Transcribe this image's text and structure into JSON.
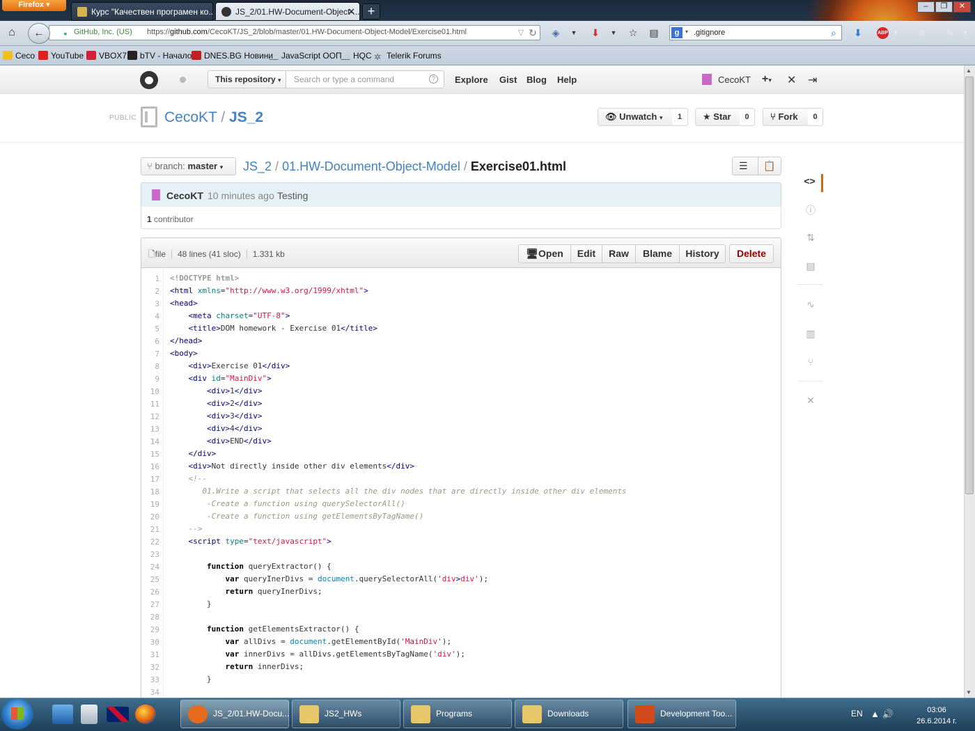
{
  "browser": {
    "menu_label": "Firefox",
    "tabs": [
      {
        "label": "Курс \"Качествен програмен ко...",
        "active": false
      },
      {
        "label": "JS_2/01.HW-Document-Object-...",
        "active": true
      }
    ],
    "new_tab": "+",
    "identity": "GitHub, Inc. (US)",
    "url_prefix": "https://",
    "url_host": "github.com",
    "url_path": "/CecoKT/JS_2/blob/master/01.HW-Document-Object-Model/Exercise01.html",
    "search_value": ".gitignore",
    "window_buttons": [
      "–",
      "❐",
      "✕"
    ]
  },
  "bookmarks": [
    {
      "label": "Ceco",
      "color": "#f0c020"
    },
    {
      "label": "YouTube",
      "color": "#e02020"
    },
    {
      "label": "VBOX7",
      "color": "#d0203a"
    },
    {
      "label": "bTV - Начало",
      "color": "#222222"
    },
    {
      "label": "DNES.BG Новини",
      "color": "#c02020"
    },
    {
      "label": "JavaScript ООП",
      "color": "#666666"
    },
    {
      "label": "HQC",
      "color": "#666666"
    },
    {
      "label": "Telerik Forums",
      "color": "#666666"
    }
  ],
  "github": {
    "scope_label": "This repository",
    "search_placeholder": "Search or type a command",
    "search_help": "?",
    "nav": [
      "Explore",
      "Gist",
      "Blog",
      "Help"
    ],
    "username": "CecoKT",
    "add_icon": "+",
    "settings_icon": "✕",
    "signout_icon": "⇥"
  },
  "repo": {
    "visibility": "PUBLIC",
    "owner": "CecoKT",
    "separator": "/",
    "name": "JS_2",
    "unwatch_label": "Unwatch",
    "unwatch_count": "1",
    "star_label": "Star",
    "star_count": "0",
    "fork_label": "Fork",
    "fork_count": "0"
  },
  "file_nav": {
    "branch_prefix": "branch:",
    "branch": "master",
    "crumb_root": "JS_2",
    "crumb_sep": "/",
    "crumb_folder": "01.HW-Document-Object-Model",
    "crumb_file": "Exercise01.html"
  },
  "commit": {
    "author": "CecoKT",
    "time": "10 minutes ago",
    "message": "Testing",
    "contributors_count": "1",
    "contributors_label": "contributor"
  },
  "file": {
    "type_label": "file",
    "lines": "48 lines (41 sloc)",
    "size": "1.331 kb",
    "buttons": [
      "Open",
      "Edit",
      "Raw",
      "Blame",
      "History"
    ],
    "delete_label": "Delete"
  },
  "code_lines": [
    "<!DOCTYPE html>",
    "<html xmlns=\"http://www.w3.org/1999/xhtml\">",
    "<head>",
    "    <meta charset=\"UTF-8\">",
    "    <title>DOM homework - Exercise 01</title>",
    "</head>",
    "<body>",
    "    <div>Exercise 01</div>",
    "    <div id=\"MainDiv\">",
    "        <div>1</div>",
    "        <div>2</div>",
    "        <div>3</div>",
    "        <div>4</div>",
    "        <div>END</div>",
    "    </div>",
    "    <div>Not directly inside other div elements</div>",
    "    <!--",
    "       01.Write a script that selects all the div nodes that are directly inside other div elements",
    "        -Create a function using querySelectorAll()",
    "        -Create a function using getElementsByTagName()",
    "    -->",
    "    <script type=\"text/javascript\">",
    "",
    "        function queryExtractor() {",
    "            var queryInerDivs = document.querySelectorAll('div>div');",
    "            return queryInerDivs;",
    "        }",
    "",
    "        function getElementsExtractor() {",
    "            var allDivs = document.getElementById('MainDiv');",
    "            var innerDivs = allDivs.getElementsByTagName('div');",
    "            return innerDivs;",
    "        }",
    ""
  ],
  "repo_sidenav": [
    "code-icon",
    "issues-icon",
    "pull-requests-icon",
    "wiki-icon",
    "pulse-icon",
    "graphs-icon",
    "network-icon",
    "settings-icon"
  ],
  "taskbar": {
    "items": [
      {
        "label": "JS_2/01.HW-Docu...",
        "color": "#e66a1c"
      },
      {
        "label": "JS2_HWs",
        "color": "#e8c76a"
      },
      {
        "label": "Programs",
        "color": "#e8c76a"
      },
      {
        "label": "Downloads",
        "color": "#e8c76a"
      },
      {
        "label": "Development Too...",
        "color": "#d04a1a"
      }
    ],
    "lang": "EN",
    "time": "03:06",
    "date": "26.6.2014 г."
  }
}
